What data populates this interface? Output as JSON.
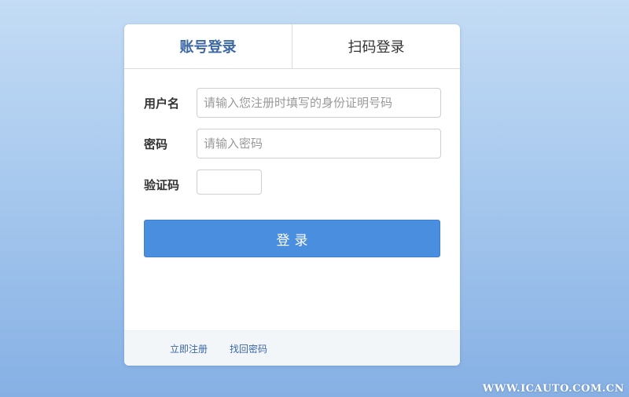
{
  "tabs": [
    {
      "label": "账号登录",
      "active": true
    },
    {
      "label": "扫码登录",
      "active": false
    }
  ],
  "form": {
    "username_label": "用户名",
    "username_placeholder": "请输入您注册时填写的身份证明号码",
    "username_value": "",
    "password_label": "密码",
    "password_placeholder": "请输入密码",
    "password_value": "",
    "captcha_label": "验证码",
    "captcha_value": ""
  },
  "login_button_label": "登录",
  "footer": {
    "register_label": "立即注册",
    "recover_label": "找回密码"
  },
  "watermark": "WWW.ICAUTO.COM.CN",
  "colors": {
    "accent": "#4a8ee0",
    "active_tab_text": "#3b67a6",
    "link": "#3b67a6"
  }
}
